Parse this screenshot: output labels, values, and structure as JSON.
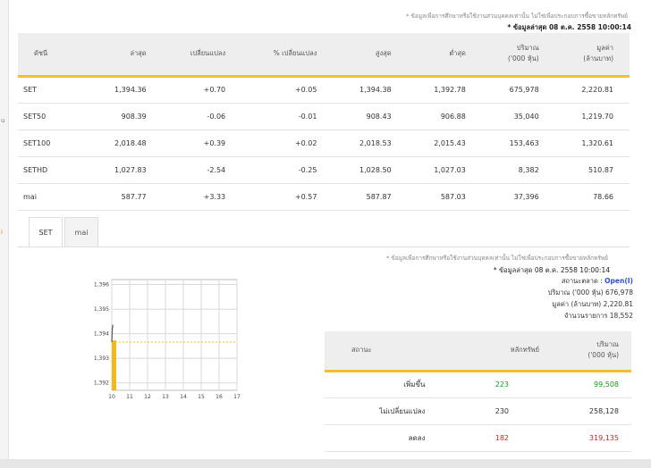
{
  "left_strip": {
    "marks": [
      "u",
      "i"
    ]
  },
  "header": {
    "note": "* ข้อมูลเพื่อการศึกษาหรือใช้งานส่วนบุคคลเท่านั้น ไม่ใช่เพื่อประกอบการซื้อขายหลักทรัพย์",
    "updated": "* ข้อมูลล่าสุด 08 ต.ค. 2558 10:00:14"
  },
  "market_table": {
    "columns": [
      "ดัชนี",
      "ล่าสุด",
      "เปลี่ยนแปลง",
      "% เปลี่ยนแปลง",
      "สูงสุด",
      "ต่ำสุด",
      "ปริมาณ\n('000 หุ้น)",
      "มูลค่า\n(ล้านบาท)"
    ],
    "rows": [
      {
        "name": "SET",
        "link": false,
        "last": "1,394.36",
        "change": "+0.70",
        "pct": "+0.05",
        "high": "1,394.38",
        "low": "1,392.78",
        "volume": "675,978",
        "value": "2,220.81",
        "dir": "pos"
      },
      {
        "name": "SET50",
        "link": true,
        "last": "908.39",
        "change": "-0.06",
        "pct": "-0.01",
        "high": "908.43",
        "low": "906.88",
        "volume": "35,040",
        "value": "1,219.70",
        "dir": "neg"
      },
      {
        "name": "SET100",
        "link": true,
        "last": "2,018.48",
        "change": "+0.39",
        "pct": "+0.02",
        "high": "2,018.53",
        "low": "2,015.43",
        "volume": "153,463",
        "value": "1,320.61",
        "dir": "pos"
      },
      {
        "name": "SETHD",
        "link": true,
        "last": "1,027.83",
        "change": "-2.54",
        "pct": "-0.25",
        "high": "1,028.50",
        "low": "1,027.03",
        "volume": "8,382",
        "value": "510.87",
        "dir": "neg"
      },
      {
        "name": "mai",
        "link": false,
        "last": "587.77",
        "change": "+3.33",
        "pct": "+0.57",
        "high": "587.87",
        "low": "587.03",
        "volume": "37,396",
        "value": "78.66",
        "dir": "pos"
      }
    ]
  },
  "tabs": [
    {
      "label": "SET",
      "active": true
    },
    {
      "label": "mai",
      "active": false
    }
  ],
  "chart_info": {
    "note": "* ข้อมูลเพื่อการศึกษาหรือใช้งานส่วนบุคคลเท่านั้น ไม่ใช่เพื่อประกอบการซื้อขายหลักทรัพย์",
    "updated": "* ข้อมูลล่าสุด 08 ต.ค. 2558 10:00:14",
    "status_label": "สถานะตลาด :",
    "status_value": "Open(I)",
    "volume_label": "ปริมาณ ('000 หุ้น)",
    "volume_value": "676,978",
    "value_label": "มูลค่า (ล้านบาท)",
    "value_value": "2,220.81",
    "deals_label": "จำนวนรายการ",
    "deals_value": "18,552"
  },
  "chart_data": {
    "type": "line",
    "x_ticks": [
      "10",
      "11",
      "12",
      "13",
      "14",
      "15",
      "16",
      "17"
    ],
    "y_ticks": [
      "1,392",
      "1,393",
      "1,394",
      "1,395",
      "1,396"
    ],
    "xlim": [
      10,
      17
    ],
    "ylim": [
      1391.7,
      1396.2
    ],
    "reference_level": 1393.66,
    "series": [
      {
        "x": [
          10.0,
          10.03,
          10.06
        ],
        "values": [
          1393.66,
          1394.2,
          1394.36
        ]
      }
    ],
    "volume_bar": {
      "x": 10.0,
      "level": 0.45
    },
    "colors": {
      "line": "#555555",
      "ref": "#f2c02e",
      "bar": "#f2b81c",
      "grid": "#d8d8d8"
    }
  },
  "summary_table": {
    "columns": [
      "สถานะ",
      "หลักทรัพย์",
      "ปริมาณ\n('000 หุ้น)"
    ],
    "rows": [
      {
        "label": "เพิ่มขึ้น",
        "count": "223",
        "volume": "99,508",
        "dir": "pos"
      },
      {
        "label": "ไม่เปลี่ยนแปลง",
        "count": "230",
        "volume": "258,128",
        "dir": "none"
      },
      {
        "label": "ลดลง",
        "count": "182",
        "volume": "319,135",
        "dir": "neg"
      }
    ]
  }
}
